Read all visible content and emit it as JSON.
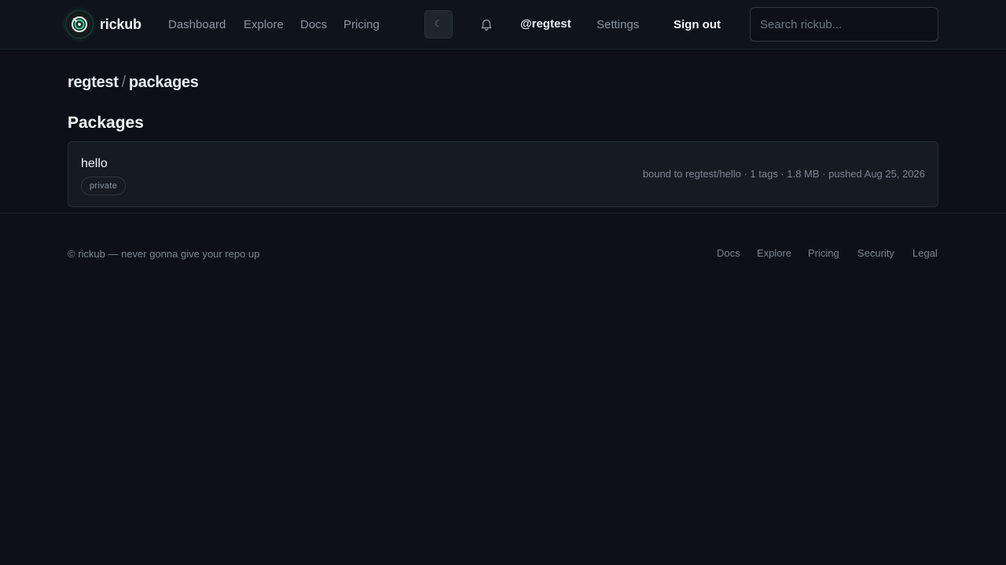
{
  "header": {
    "brand": "rickub",
    "nav": [
      "Dashboard",
      "Explore",
      "Docs",
      "Pricing"
    ],
    "theme_toggle_glyph": "☾",
    "user": "@regtest",
    "settings": "Settings",
    "sign_out": "Sign out",
    "search_placeholder": "Search rickub..."
  },
  "breadcrumb": {
    "owner": "regtest",
    "separator": "/",
    "page": "packages"
  },
  "main": {
    "title": "Packages",
    "packages": [
      {
        "name": "hello",
        "visibility": "private",
        "meta": "bound to regtest/hello · 1 tags · 1.8 MB · pushed Aug 25, 2026"
      }
    ]
  },
  "footer": {
    "copyright": "© rickub — never gonna give your repo up",
    "links": [
      "Docs",
      "Explore",
      "Pricing",
      "Security",
      "Legal"
    ]
  },
  "colors": {
    "background": "#0d1117",
    "accent": "#3fd09a"
  }
}
